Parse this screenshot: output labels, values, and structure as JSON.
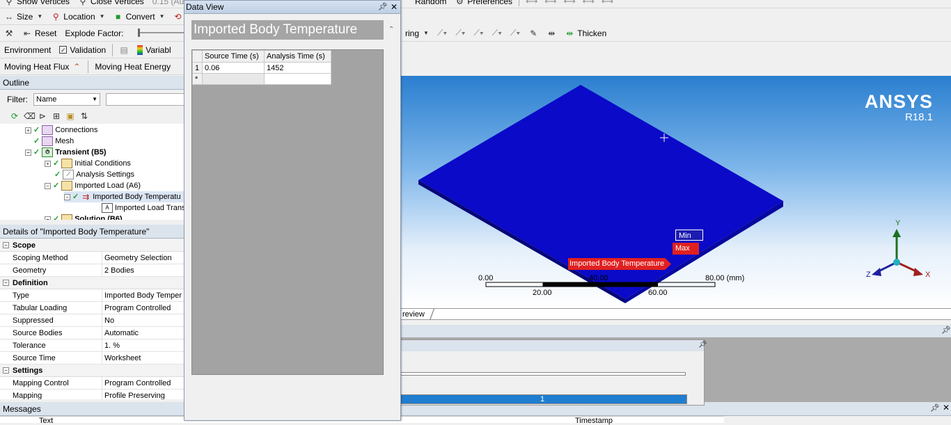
{
  "toolbar1": {
    "show_vertices": "Show Vertices",
    "close_vertices": "Close Vertices",
    "version_frag": "0.15 (Au",
    "random": "Random",
    "preferences": "Preferences"
  },
  "toolbar2": {
    "size": "Size",
    "location": "Location",
    "convert": "Convert",
    "m_frag": "M"
  },
  "toolbar3": {
    "reset": "Reset",
    "explode_factor": "Explode Factor:",
    "ring_frag": "ring",
    "thicken": "Thicken"
  },
  "toolbar4": {
    "environment": "Environment",
    "validation": "Validation",
    "variable_frag": "Variabl"
  },
  "toolbar5": {
    "moving_heat_flux": "Moving Heat Flux",
    "moving_heat_energy": "Moving Heat Energy"
  },
  "outline": {
    "title": "Outline",
    "filter_label": "Filter:",
    "filter_value": "Name",
    "tree": [
      {
        "label": "Connections",
        "bold": false
      },
      {
        "label": "Mesh",
        "bold": false
      },
      {
        "label": "Transient (B5)",
        "bold": true
      },
      {
        "label": "Initial Conditions",
        "bold": false
      },
      {
        "label": "Analysis Settings",
        "bold": false
      },
      {
        "label": "Imported Load (A6)",
        "bold": false
      },
      {
        "label": "Imported Body Temperatu",
        "bold": false
      },
      {
        "label": "Imported Load Trans",
        "bold": false
      },
      {
        "label": "Solution (B6)",
        "bold": true
      }
    ]
  },
  "details": {
    "title": "Details of \"Imported Body Temperature\"",
    "sections": [
      {
        "name": "Scope",
        "rows": [
          {
            "key": "Scoping Method",
            "value": "Geometry Selection"
          },
          {
            "key": "Geometry",
            "value": "2 Bodies"
          }
        ]
      },
      {
        "name": "Definition",
        "rows": [
          {
            "key": "Type",
            "value": "Imported Body Temper"
          },
          {
            "key": "Tabular Loading",
            "value": "Program Controlled"
          },
          {
            "key": "Suppressed",
            "value": "No"
          },
          {
            "key": "Source Bodies",
            "value": "Automatic"
          },
          {
            "key": "Tolerance",
            "value": "1. %"
          },
          {
            "key": "Source Time",
            "value": "Worksheet"
          }
        ]
      },
      {
        "name": "Settings",
        "rows": [
          {
            "key": "Mapping Control",
            "value": "Program Controlled"
          },
          {
            "key": "Mapping",
            "value": "Profile Preserving"
          }
        ]
      }
    ]
  },
  "messages": {
    "title": "Messages",
    "col_text": "Text",
    "col_timestamp": "Timestamp"
  },
  "data_view": {
    "window_title": "Data View",
    "heading": "Imported Body Temperature",
    "col_index": "",
    "col_source_time": "Source Time (s)",
    "col_analysis_time": "Analysis Time (s)",
    "rows": [
      {
        "index": "1",
        "source_time": "0.06",
        "analysis_time": "1452"
      },
      {
        "index": "*",
        "source_time": "",
        "analysis_time": ""
      }
    ]
  },
  "viewport": {
    "brand": "ANSYS",
    "version": "R18.1",
    "min_label": "Min",
    "max_label": "Max",
    "load_label": "Imported Body Temperature",
    "scale": {
      "top_labels": [
        "0.00",
        "40.00",
        "80.00 (mm)"
      ],
      "bottom_labels": [
        "20.00",
        "60.00"
      ]
    },
    "axes": {
      "y": "Y",
      "z": "Z",
      "x": "X"
    },
    "tab_label": "review",
    "plate_color": "#0a0ac8",
    "accent_red": "#e02020"
  },
  "progress": {
    "value_label": "1",
    "bar_color": "#1f7ed0",
    "fraction": 1
  }
}
